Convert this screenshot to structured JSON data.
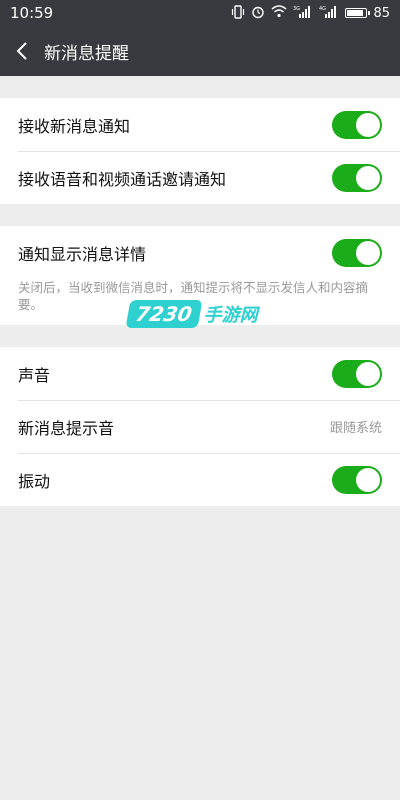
{
  "status_bar": {
    "time": "10:59",
    "signal_1_label": "3G",
    "signal_2_label": "4G",
    "battery_level": "85"
  },
  "header": {
    "title": "新消息提醒"
  },
  "groups": [
    {
      "rows": [
        {
          "label": "接收新消息通知",
          "toggle": true
        },
        {
          "label": "接收语音和视频通话邀请通知",
          "toggle": true
        }
      ]
    },
    {
      "rows": [
        {
          "label": "通知显示消息详情",
          "toggle": true
        }
      ],
      "hint": "关闭后，当收到微信消息时，通知提示将不显示发信人和内容摘要。"
    },
    {
      "rows": [
        {
          "label": "声音",
          "toggle": true
        },
        {
          "label": "新消息提示音",
          "value": "跟随系统"
        },
        {
          "label": "振动",
          "toggle": true
        }
      ]
    }
  ],
  "watermark": {
    "badge": "7230",
    "text": "手游网"
  },
  "colors": {
    "header_bg": "#393a3f",
    "toggle_on": "#1aad19",
    "page_bg": "#ededed"
  }
}
